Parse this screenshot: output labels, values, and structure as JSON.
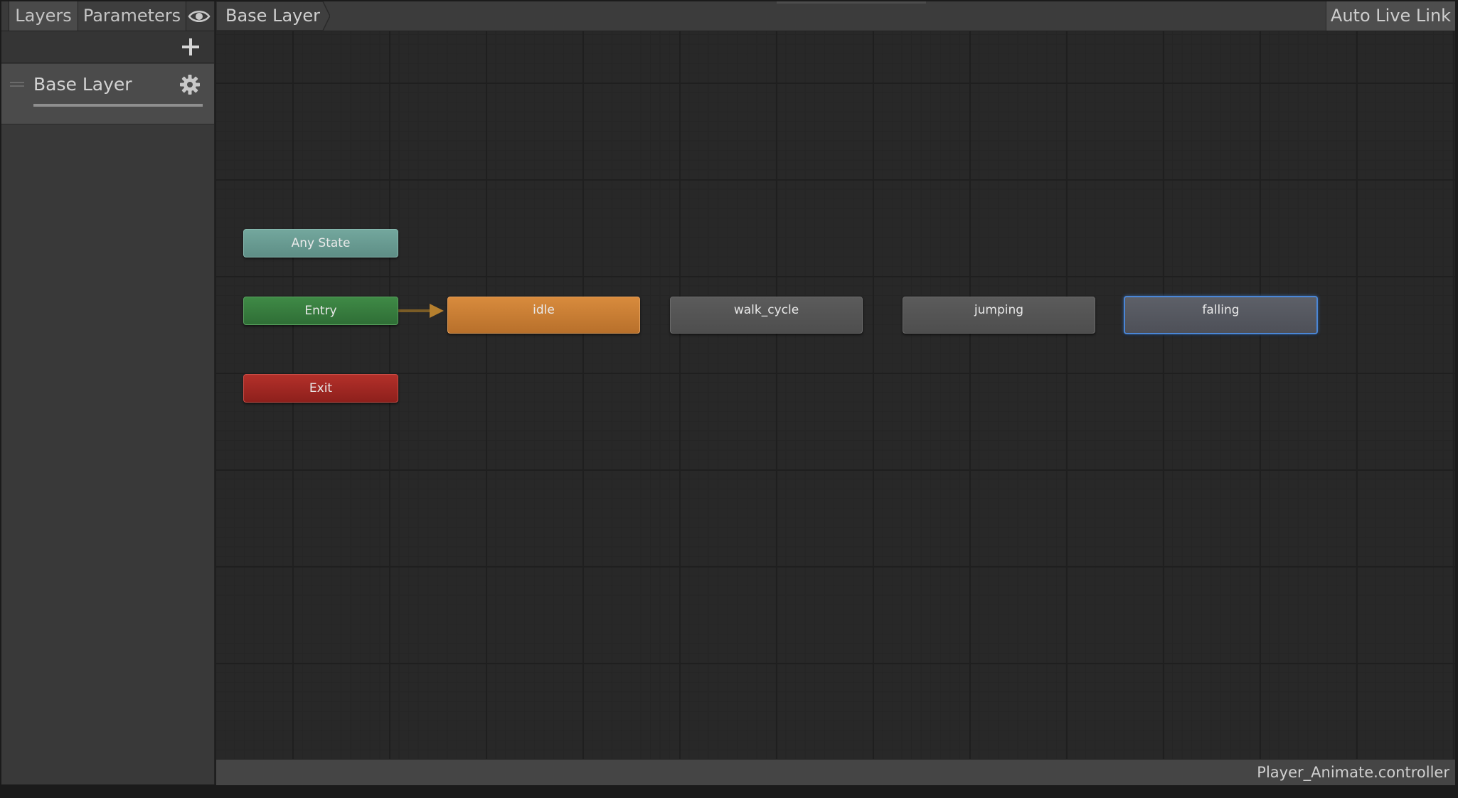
{
  "left_panel": {
    "tabs": [
      {
        "label": "Layers"
      },
      {
        "label": "Parameters"
      }
    ],
    "eye_icon": "eye-icon",
    "add_icon": "plus-icon",
    "layers": [
      {
        "name": "Base Layer",
        "weight": 1.0,
        "settings_icon": "gear-icon"
      }
    ]
  },
  "graph": {
    "breadcrumb": "Base Layer",
    "auto_live_link": "Auto Live Link",
    "states": {
      "any_state": "Any State",
      "entry": "Entry",
      "exit": "Exit",
      "idle": "idle",
      "walk_cycle": "walk_cycle",
      "jumping": "jumping",
      "falling": "falling"
    },
    "default_state": "idle",
    "selected_state": "falling",
    "colors": {
      "any_state": "#6a9c93",
      "entry": "#377c3e",
      "exit": "#a12823",
      "default_state": "#c87d34",
      "normal_state": "#555555",
      "selection": "#4a86d6",
      "transition": "#8a6a2a"
    }
  },
  "footer": {
    "file_name": "Player_Animate.controller"
  }
}
